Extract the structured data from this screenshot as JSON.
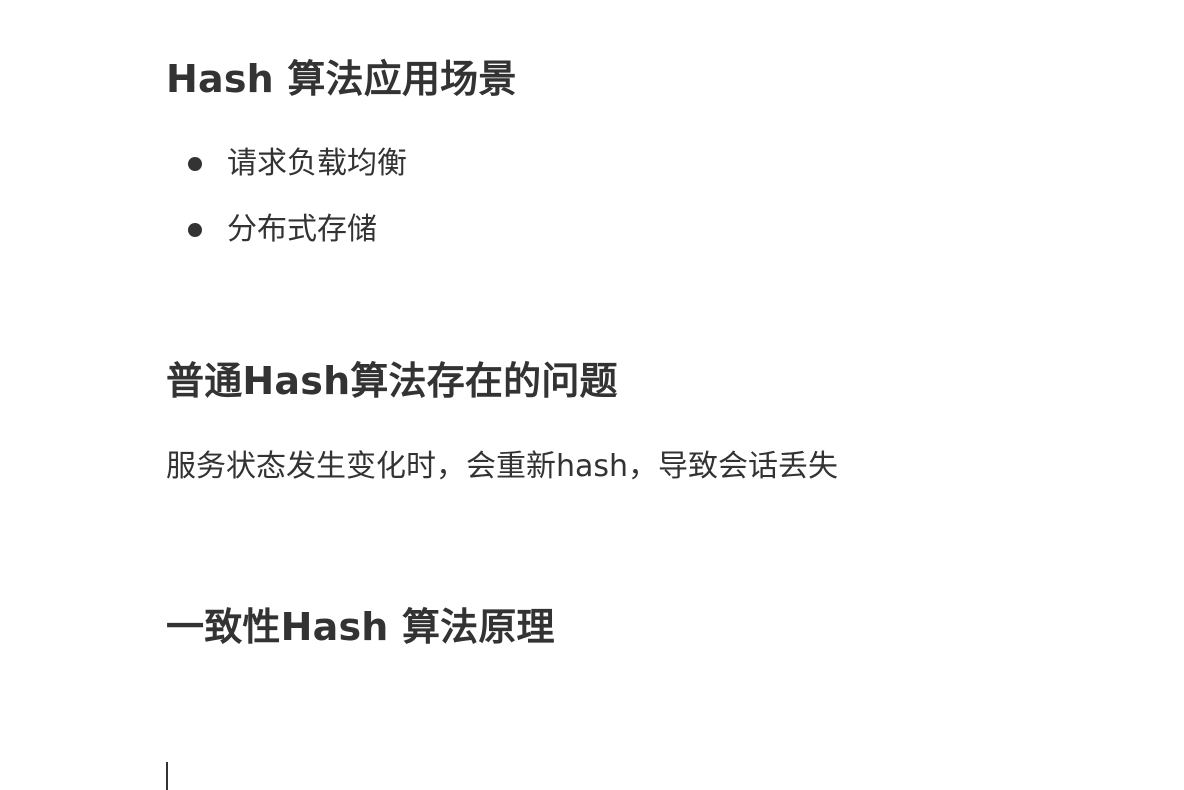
{
  "document": {
    "section1": {
      "heading": "Hash 算法应用场景",
      "bullets": [
        "请求负载均衡",
        "分布式存储"
      ]
    },
    "section2": {
      "heading": "普通Hash算法存在的问题",
      "paragraph": "服务状态发生变化时，会重新hash，导致会话丢失"
    },
    "section3": {
      "heading": "一致性Hash 算法原理"
    }
  }
}
